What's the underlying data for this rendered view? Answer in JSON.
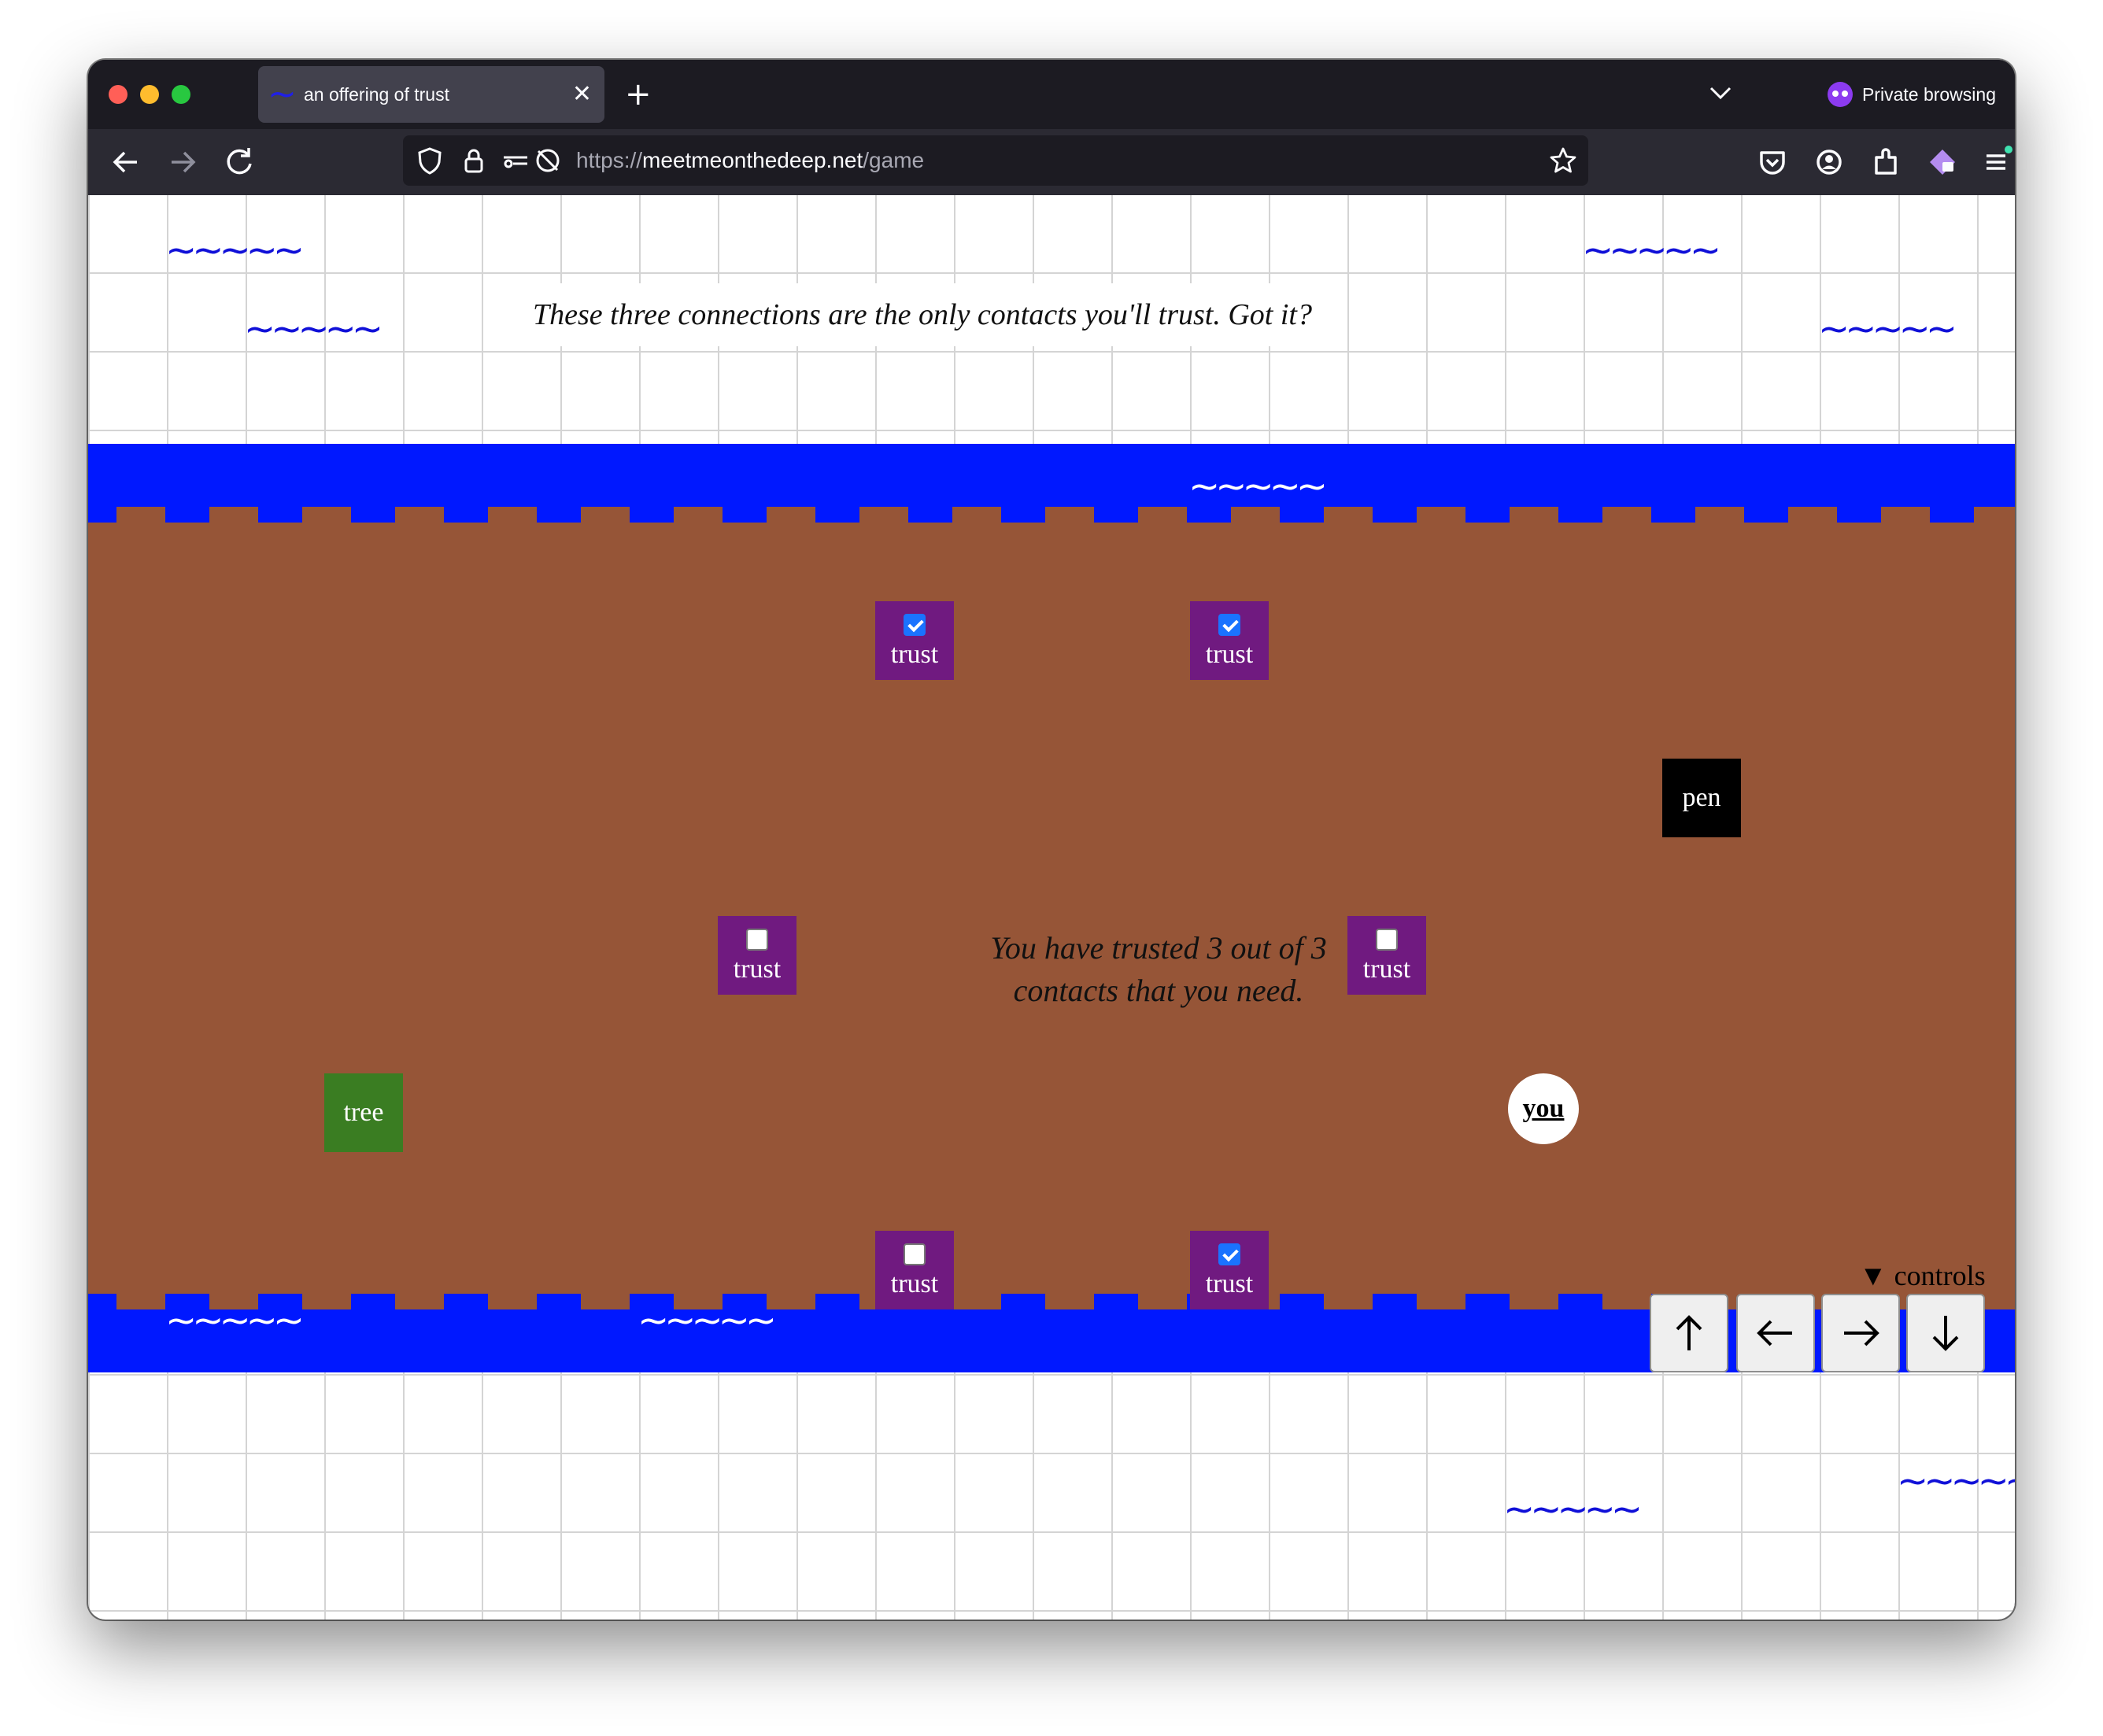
{
  "browser": {
    "tab_title": "an offering of trust",
    "tab_favicon": "~",
    "tab_close": "✕",
    "new_tab": "+",
    "private_label": "Private browsing",
    "url_scheme": "https://",
    "url_domain": "meetmeonthedeep.net",
    "url_path": "/game"
  },
  "game": {
    "top_message": "These three connections are the only contacts you'll trust. Got it?",
    "status_line1": "You have trusted 3 out of 3",
    "status_line2": "contacts that you need.",
    "trust_tiles": [
      {
        "label": "trust",
        "checked": true
      },
      {
        "label": "trust",
        "checked": true
      },
      {
        "label": "trust",
        "checked": false
      },
      {
        "label": "trust",
        "checked": false
      },
      {
        "label": "trust",
        "checked": false
      },
      {
        "label": "trust",
        "checked": true
      }
    ],
    "pen_label": "pen",
    "tree_label": "tree",
    "you_label": "you",
    "wave_glyphs": "~~~~~",
    "colors": {
      "water": "#0018ff",
      "ground": "#965537",
      "trust_tile": "#701a80",
      "tree_tile": "#3a7d22",
      "pen_tile": "#000000",
      "wave": "#1010d8"
    }
  },
  "controls": {
    "toggle_label": "▼  controls",
    "up": "up-arrow-icon",
    "left": "left-arrow-icon",
    "right": "right-arrow-icon",
    "down": "down-arrow-icon"
  }
}
